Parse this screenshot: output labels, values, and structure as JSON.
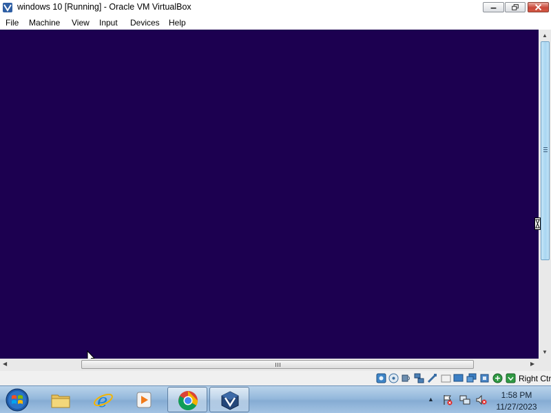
{
  "window": {
    "title": "windows 10 [Running] - Oracle VM VirtualBox",
    "icon": "virtualbox-icon",
    "controls": [
      "minimize-icon",
      "maximize-icon",
      "close-icon"
    ]
  },
  "menubar": {
    "items": [
      {
        "label": "File"
      },
      {
        "label": "Machine"
      },
      {
        "label": "View"
      },
      {
        "label": "Input"
      },
      {
        "label": "Devices"
      },
      {
        "label": "Help"
      }
    ]
  },
  "vm_screen": {
    "background_color": "#1c0050"
  },
  "statusbar": {
    "device_icons": [
      "hard-disk-icon",
      "optical-drive-icon",
      "audio-icon",
      "network-icon",
      "usb-icon",
      "shared-folders-icon",
      "display-icon",
      "video-capture-icon",
      "cpu-icon",
      "mouse-integration-icon",
      "keyboard-capture-icon"
    ],
    "host_key": "Right Ctrl"
  },
  "taskbar": {
    "start": "windows-start-orb-icon",
    "pinned": [
      {
        "name": "file-explorer-icon",
        "active": false
      },
      {
        "name": "internet-explorer-icon",
        "active": false
      },
      {
        "name": "media-player-icon",
        "active": false
      },
      {
        "name": "chrome-icon",
        "active": true
      },
      {
        "name": "virtualbox-icon",
        "active": true
      }
    ],
    "tray": {
      "icons": [
        "show-hidden-icons-arrow",
        "action-center-flag-icon",
        "network-icon",
        "volume-muted-icon"
      ],
      "time": "1:58 PM",
      "date": "11/27/2023"
    }
  }
}
